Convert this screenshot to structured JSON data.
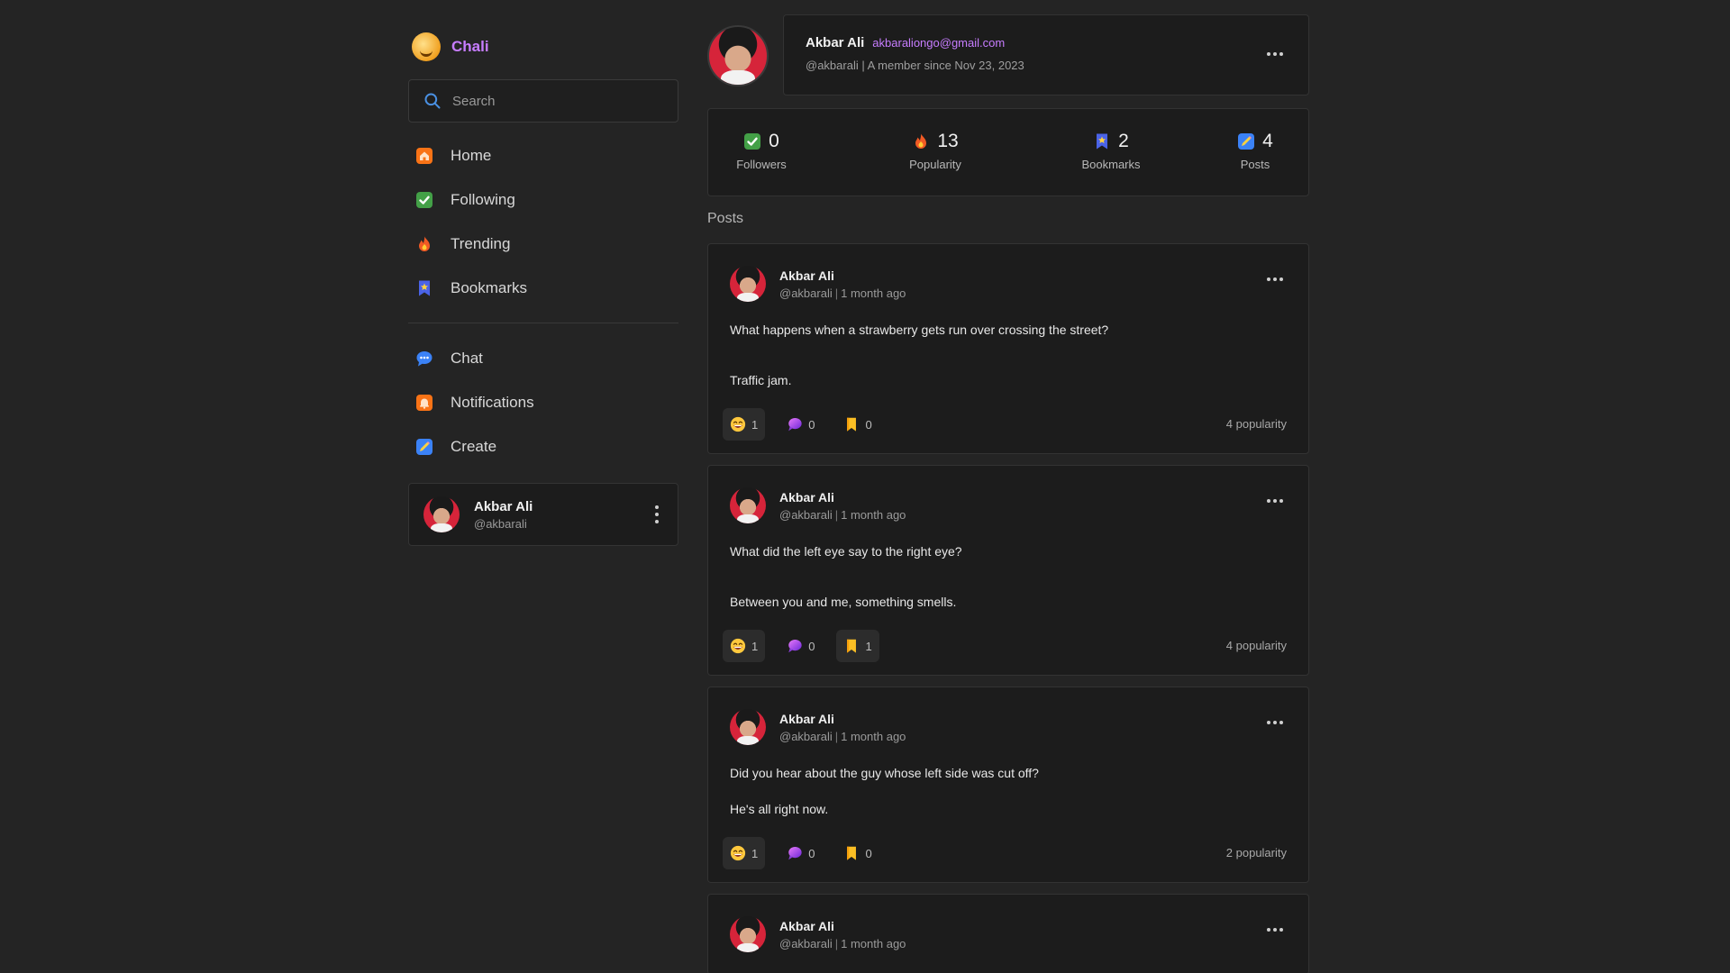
{
  "brand": {
    "name": "Chali"
  },
  "search": {
    "placeholder": "Search"
  },
  "nav": {
    "primary": [
      {
        "id": "home",
        "label": "Home",
        "icon": "home-icon",
        "color": "#f97316"
      },
      {
        "id": "following",
        "label": "Following",
        "icon": "check-icon",
        "color": "#4caf50"
      },
      {
        "id": "trending",
        "label": "Trending",
        "icon": "fire-icon",
        "color": "#f15a24"
      },
      {
        "id": "bookmarks",
        "label": "Bookmarks",
        "icon": "bookmark-star-icon",
        "color": "#4a63e7"
      }
    ],
    "secondary": [
      {
        "id": "chat",
        "label": "Chat",
        "icon": "chat-icon",
        "color": "#3b82f6"
      },
      {
        "id": "notifications",
        "label": "Notifications",
        "icon": "bell-icon",
        "color": "#f97316"
      },
      {
        "id": "create",
        "label": "Create",
        "icon": "pencil-icon",
        "color": "#3b82f6"
      }
    ]
  },
  "current_user": {
    "name": "Akbar Ali",
    "handle": "@akbarali"
  },
  "profile": {
    "name": "Akbar Ali",
    "email": "akbaraliongo@gmail.com",
    "subline": "@akbarali | A member since Nov 23, 2023"
  },
  "stats": [
    {
      "id": "followers",
      "value": "0",
      "label": "Followers",
      "icon": "check-icon"
    },
    {
      "id": "popularity",
      "value": "13",
      "label": "Popularity",
      "icon": "fire-icon"
    },
    {
      "id": "bookmarks",
      "value": "2",
      "label": "Bookmarks",
      "icon": "bookmark-star-icon"
    },
    {
      "id": "posts",
      "value": "4",
      "label": "Posts",
      "icon": "pencil-icon"
    }
  ],
  "posts_heading": "Posts",
  "posts": [
    {
      "author": "Akbar Ali",
      "handle": "@akbarali",
      "time": "1 month ago",
      "lines": [
        "What happens when a strawberry gets run over crossing the street?",
        "Traffic jam."
      ],
      "gap": "lg",
      "reactions": "1",
      "reactions_active": true,
      "comments": "0",
      "comments_active": false,
      "bookmarks": "0",
      "bookmarks_active": false,
      "popularity": "4 popularity"
    },
    {
      "author": "Akbar Ali",
      "handle": "@akbarali",
      "time": "1 month ago",
      "lines": [
        "What did the left eye say to the right eye?",
        "Between you and me, something smells."
      ],
      "gap": "lg",
      "reactions": "1",
      "reactions_active": true,
      "comments": "0",
      "comments_active": false,
      "bookmarks": "1",
      "bookmarks_active": true,
      "popularity": "4 popularity"
    },
    {
      "author": "Akbar Ali",
      "handle": "@akbarali",
      "time": "1 month ago",
      "lines": [
        "Did you hear about the guy whose left side was cut off?",
        "He's all right now."
      ],
      "gap": "sm",
      "reactions": "1",
      "reactions_active": true,
      "comments": "0",
      "comments_active": false,
      "bookmarks": "0",
      "bookmarks_active": false,
      "popularity": "2 popularity"
    },
    {
      "author": "Akbar Ali",
      "handle": "@akbarali",
      "time": "1 month ago",
      "lines": [],
      "gap": "sm",
      "partial": true
    }
  ]
}
